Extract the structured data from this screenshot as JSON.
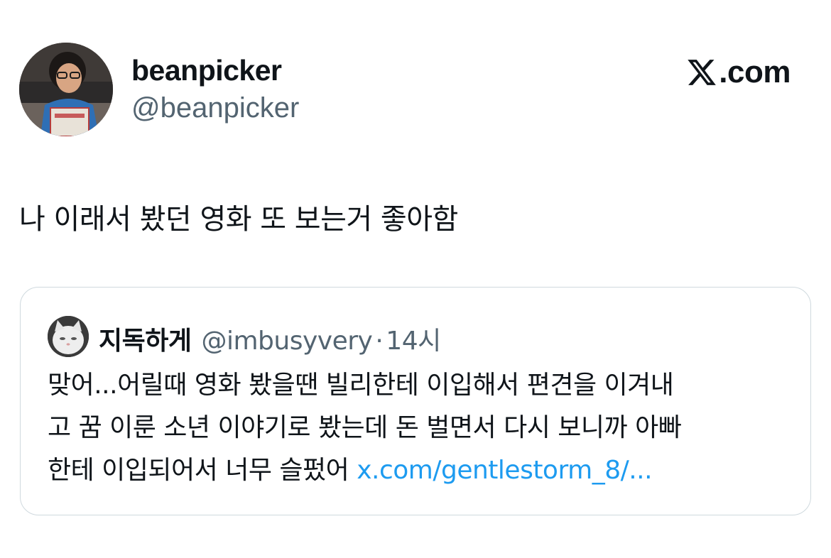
{
  "author": {
    "display_name": "beanpicker",
    "handle": "@beanpicker"
  },
  "brand": {
    "text": ".com",
    "icon": "x-logo-icon"
  },
  "tweet": {
    "text": "나 이래서 봤던 영화 또 보는거 좋아함"
  },
  "quoted_tweet": {
    "display_name": "지독하게",
    "handle": "@imbusyvery",
    "separator": "·",
    "time": "14시",
    "body_lines": [
      "맞어...어릴때 영화 봤을땐 빌리한테 이입해서 편견을 이겨내",
      "고 꿈 이룬 소년 이야기로 봤는데 돈 벌면서 다시 보니까 아빠",
      "한테 이입되어서 너무 슬펐어 "
    ],
    "link_text": "x.com/gentlestorm_8/...",
    "link_color": "#1d9bf0"
  },
  "colors": {
    "text_primary": "#0f1419",
    "text_secondary": "#536471",
    "border": "#cfd9de"
  }
}
